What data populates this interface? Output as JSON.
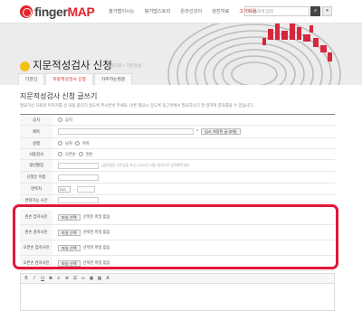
{
  "header": {
    "logo_text": "finger",
    "logo_map": "MAP",
    "nav": [
      "핑거맵이시는",
      "핑거맵스토리",
      "온라인강의",
      "검진자료",
      "고객지원"
    ],
    "search_placeholder": "Birds검색 입력",
    "search_icon": "🔍"
  },
  "page": {
    "title": "지문적성검사 신청",
    "subtitle": "고객지원 > 지문적성",
    "tabs": [
      "더큰인",
      "지문적성검사 신청",
      "자주하는질문"
    ],
    "form_title": "지문적성검사 신청 글쓰기",
    "notice": "필요하신 자료의 미미지를 선 내용 올리기 정도록 주시면서 주세요. 이른 필요시 장도록 동근이에서 필요하나다 연 결하여 결과를을 수 있습니다."
  },
  "form": {
    "rows": [
      {
        "label": "공지",
        "radio1": "공지"
      },
      {
        "label": "제목",
        "button": "임시 저장된 글 (0개)"
      },
      {
        "label": "성별",
        "radio1": "남자",
        "radio2": "여자"
      },
      {
        "label": "사용검사",
        "radio1": "오른손",
        "radio2": "왼손"
      },
      {
        "label": "생년월일",
        "hint": "(생년월일 기준일을 표시 (2000년 0월) 형식으로 입력해주세요"
      },
      {
        "label": "신청인 이름"
      },
      {
        "label": "연락처",
        "select": "010"
      },
      {
        "label": "연락가능 시간"
      }
    ],
    "file_rows": [
      {
        "label": "왼손 엄지사진",
        "button": "파일 선택",
        "status": "선택된 파일 없음"
      },
      {
        "label": "왼손 검지사진",
        "button": "파일 선택",
        "status": "선택된 파일 없음"
      },
      {
        "label": "오른손 엄지사진",
        "button": "파일 선택",
        "status": "선택된 파일 없음"
      },
      {
        "label": "오른손 검지사진",
        "button": "파일 선택",
        "status": "선택된 파일 없음"
      }
    ],
    "editor_label": "내용"
  },
  "colors": {
    "brand": "#e2232a",
    "highlight": "#e2173a",
    "title_dot": "#f2c21b"
  }
}
